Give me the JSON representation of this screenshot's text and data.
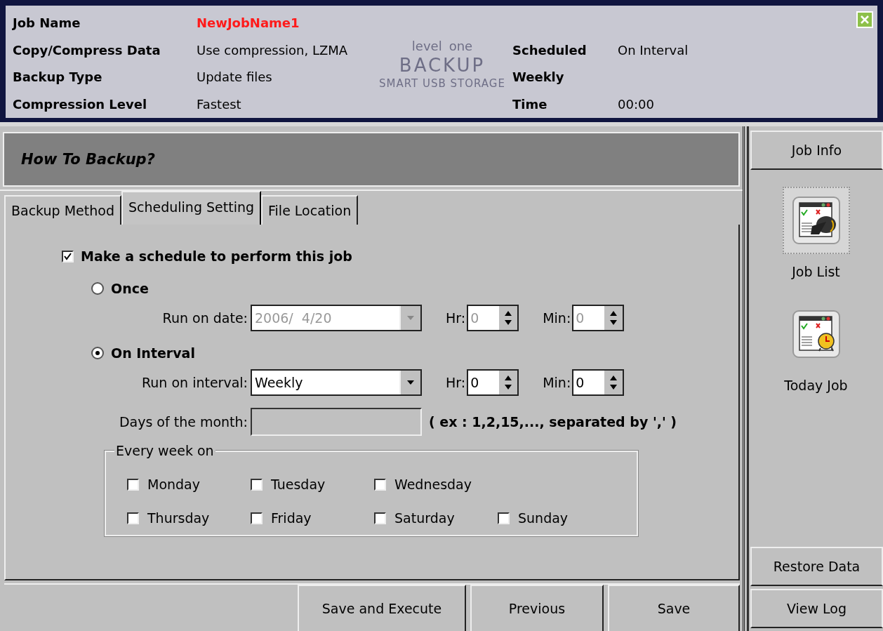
{
  "header": {
    "brand": "level",
    "brand_sub": "one",
    "product": "BACKUP",
    "tagline": "SMART USB STORAGE",
    "left": [
      {
        "label": "Job Name",
        "value": "NewJobName1",
        "highlight": true
      },
      {
        "label": "Copy/Compress Data",
        "value": "Use compression, LZMA",
        "highlight": false
      },
      {
        "label": "Backup Type",
        "value": "Update files",
        "highlight": false
      },
      {
        "label": "Compression Level",
        "value": "Fastest",
        "highlight": false
      }
    ],
    "right": [
      {
        "label": "Scheduled",
        "value": "On Interval"
      },
      {
        "label": "Weekly"
      },
      {
        "label": "Time",
        "value": "00:00"
      }
    ]
  },
  "panel_title": "How To Backup?",
  "tabs": [
    {
      "label": "Backup Method",
      "selected": false
    },
    {
      "label": "Scheduling Setting",
      "selected": true
    },
    {
      "label": "File Location",
      "selected": false
    }
  ],
  "schedule": {
    "checkbox": {
      "label": "Make a schedule to perform this job",
      "checked": true
    },
    "options": [
      {
        "label": "Once",
        "selected": false,
        "field_label": "Run on date:",
        "field_value": "2006/  4/20",
        "disabled": true,
        "hr_label": "Hr:",
        "hr_value": "0",
        "min_label": "Min:",
        "min_value": "0"
      },
      {
        "label": "On Interval",
        "selected": true,
        "field_label": "Run on interval:",
        "field_value": "Weekly",
        "disabled": false,
        "hr_label": "Hr:",
        "hr_value": "0",
        "min_label": "Min:",
        "min_value": "0"
      }
    ],
    "days_of_month": {
      "label": "Days of the month:",
      "hint": "( ex : 1,2,15,..., separated by ',' )"
    },
    "week_group": {
      "title": "Every week on",
      "days": [
        {
          "label": "Monday",
          "checked": false
        },
        {
          "label": "Tuesday",
          "checked": false
        },
        {
          "label": "Wednesday",
          "checked": false
        },
        {
          "label": "Thursday",
          "checked": false
        },
        {
          "label": "Friday",
          "checked": false
        },
        {
          "label": "Saturday",
          "checked": false
        },
        {
          "label": "Sunday",
          "checked": false
        }
      ]
    }
  },
  "buttons": [
    "Save and Execute",
    "Previous",
    "Save"
  ],
  "sidebar": {
    "top": "Job Info",
    "items": [
      {
        "label": "Job List",
        "kind": "list",
        "selected": true
      },
      {
        "label": "Today Job",
        "kind": "clock",
        "selected": false
      }
    ],
    "bottom": [
      "Restore Data",
      "View Log"
    ]
  }
}
